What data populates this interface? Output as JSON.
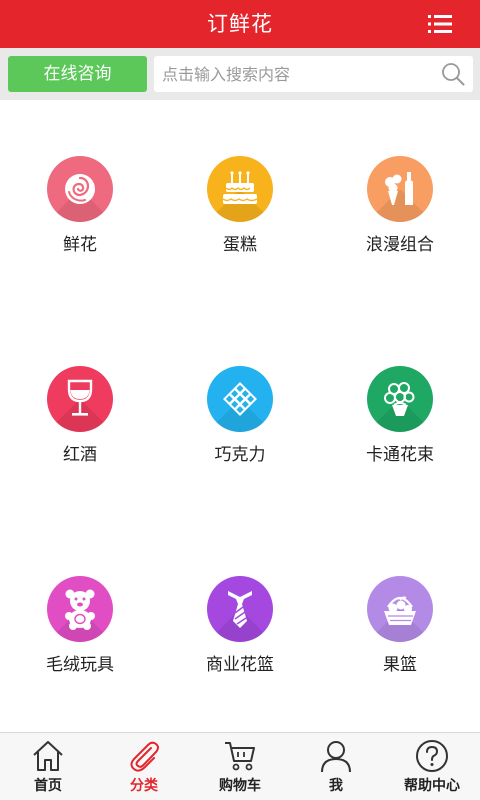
{
  "header": {
    "title": "订鲜花",
    "menu_icon": "list-menu-icon"
  },
  "search": {
    "consult_label": "在线咨询",
    "placeholder": "点击输入搜索内容",
    "value": ""
  },
  "categories": [
    {
      "label": "鲜花",
      "icon": "rose-icon",
      "color": "#f06a7f"
    },
    {
      "label": "蛋糕",
      "icon": "cake-icon",
      "color": "#f7b21c"
    },
    {
      "label": "浪漫组合",
      "icon": "bouquet-bottle-icon",
      "color": "#f89e62"
    },
    {
      "label": "红酒",
      "icon": "wine-glass-icon",
      "color": "#ee3b5e"
    },
    {
      "label": "巧克力",
      "icon": "chocolate-icon",
      "color": "#23b2ef"
    },
    {
      "label": "卡通花束",
      "icon": "flower-bouquet-icon",
      "color": "#1fa864"
    },
    {
      "label": "毛绒玩具",
      "icon": "teddy-bear-icon",
      "color": "#e14ec4"
    },
    {
      "label": "商业花篮",
      "icon": "necktie-icon",
      "color": "#a448df"
    },
    {
      "label": "果篮",
      "icon": "fruit-basket-icon",
      "color": "#b38be6"
    }
  ],
  "tabbar": {
    "active_color": "#e4252c",
    "items": [
      {
        "label": "首页",
        "icon": "home-icon"
      },
      {
        "label": "分类",
        "icon": "paperclip-icon"
      },
      {
        "label": "购物车",
        "icon": "cart-icon"
      },
      {
        "label": "我",
        "icon": "user-icon"
      },
      {
        "label": "帮助中心",
        "icon": "help-icon"
      }
    ]
  }
}
